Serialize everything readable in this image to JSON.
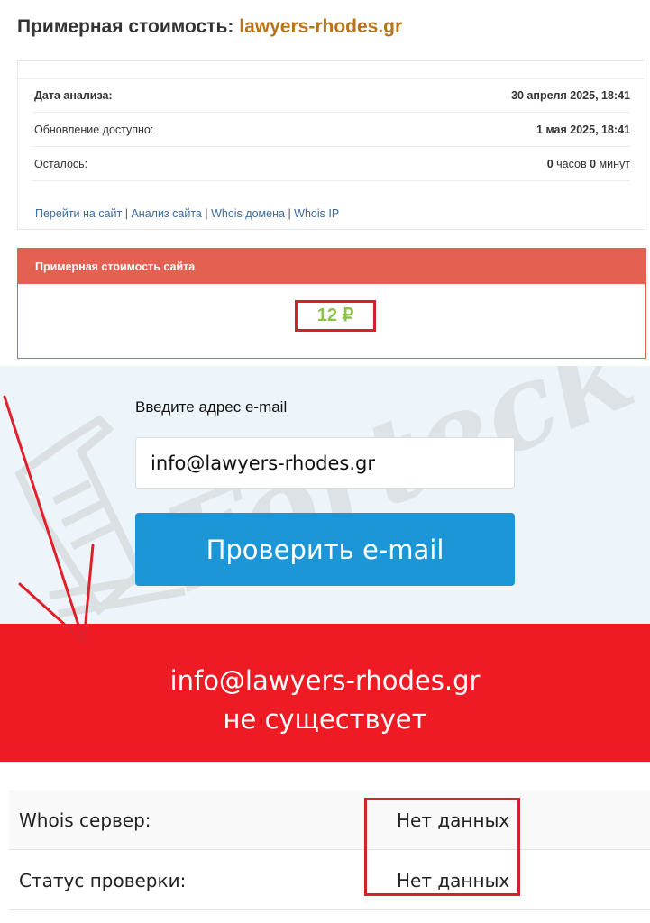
{
  "header": {
    "prefix": "Примерная стоимость:",
    "domain": "lawyers-rhodes.gr"
  },
  "info": {
    "rows": [
      {
        "label": "Дата анализа:",
        "value": "30 апреля 2025, 18:41"
      },
      {
        "label": "Обновление доступно:",
        "value": "1 мая 2025, 18:41"
      }
    ],
    "remaining": {
      "label": "Осталось:",
      "hours": "0",
      "hours_unit": "часов",
      "minutes": "0",
      "minutes_unit": "минут"
    },
    "links": [
      "Перейти на сайт",
      "Анализ сайта",
      "Whois домена",
      "Whois IP"
    ],
    "link_separator": "|"
  },
  "price_panel": {
    "title": "Примерная стоимость сайта",
    "value": "12 ₽"
  },
  "email_check": {
    "label": "Введите адрес e-mail",
    "input_value": "info@lawyers-rhodes.gr",
    "button_label": "Проверить e-mail",
    "result_line1": "info@lawyers-rhodes.gr",
    "result_line2": "не существует"
  },
  "whois": [
    {
      "label": "Whois сервер:",
      "value": "Нет данных"
    },
    {
      "label": "Статус проверки:",
      "value": "Нет данных"
    }
  ],
  "watermark": {
    "text": "Forteck"
  },
  "colors": {
    "domain_accent": "#b8741a",
    "panel_header": "#e46051",
    "price_green": "#8bc34a",
    "button_blue": "#1c96d6",
    "result_red": "#ee1b24",
    "highlight_red": "#d0232b"
  }
}
